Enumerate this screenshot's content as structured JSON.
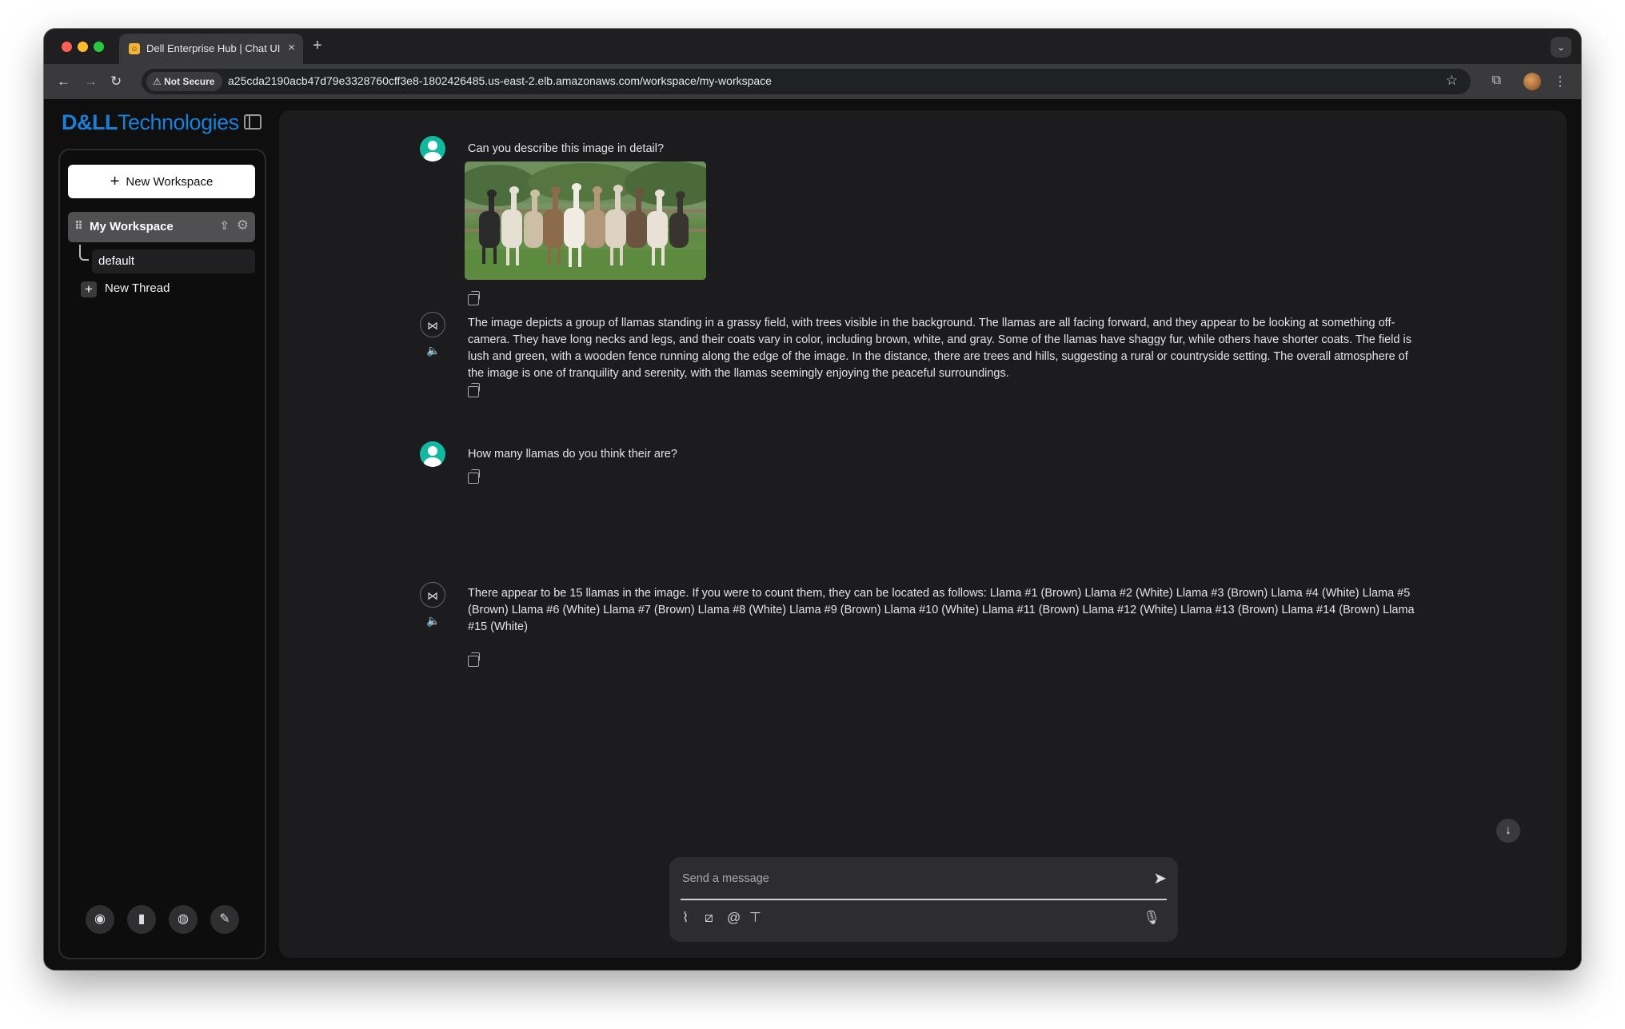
{
  "browser": {
    "tab_title": "Dell Enterprise Hub | Chat UI",
    "tab_close": "×",
    "new_tab": "+",
    "security_label": "Not Secure",
    "url": "a25cda2190acb47d79e3328760cff3e8-1802426485.us-east-2.elb.amazonaws.com/workspace/my-workspace"
  },
  "brand": {
    "logo_dell": "D&LL",
    "logo_tech": "Technologies",
    "color": "#1a7fd6"
  },
  "sidebar": {
    "new_workspace_label": "New Workspace",
    "workspace_name": "My Workspace",
    "threads": [
      "default"
    ],
    "new_thread_label": "New Thread",
    "footer_icons": [
      "github-icon",
      "docs-book-icon",
      "discord-icon",
      "settings-wrench-icon"
    ]
  },
  "chat": {
    "messages": [
      {
        "role": "user",
        "text": "Can you describe this image in detail?",
        "has_image": true
      },
      {
        "role": "assistant",
        "text": "The image depicts a group of llamas standing in a grassy field, with trees visible in the background. The llamas are all facing forward, and they appear to be looking at something off-camera. They have long necks and legs, and their coats vary in color, including brown, white, and gray. Some of the llamas have shaggy fur, while others have shorter coats. The field is lush and green, with a wooden fence running along the edge of the image. In the distance, there are trees and hills, suggesting a rural or countryside setting. The overall atmosphere of the image is one of tranquility and serenity, with the llamas seemingly enjoying the peaceful surroundings."
      },
      {
        "role": "user",
        "text": "How many llamas do you think their are?"
      },
      {
        "role": "assistant",
        "text": "There appear to be 15 llamas in the image. If you were to count them, they can be located as follows: Llama #1 (Brown) Llama #2 (White) Llama #3 (Brown) Llama #4 (White) Llama #5 (Brown) Llama #6 (White) Llama #7 (Brown) Llama #8 (White) Llama #9 (Brown) Llama #10 (White) Llama #11 (Brown) Llama #12 (White) Llama #13 (Brown) Llama #14 (Brown) Llama #15 (White)"
      }
    ],
    "composer_placeholder": "Send a message",
    "accent_user_avatar": "#10b9a0"
  }
}
